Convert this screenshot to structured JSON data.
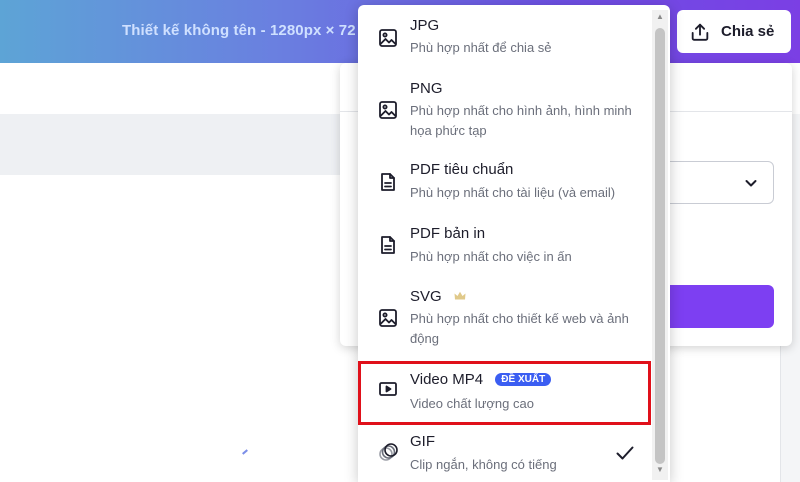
{
  "header": {
    "doc_title": "Thiết kế không tên - 1280px × 72",
    "share_label": "Chia sẻ"
  },
  "colors": {
    "accent": "#7d3ff2",
    "badge": "#3b5ef2",
    "highlight": "#e0101a"
  },
  "menu": {
    "items": [
      {
        "name": "JPG",
        "desc": "Phù hợp nhất để chia sẻ",
        "icon": "image-icon"
      },
      {
        "name": "PNG",
        "desc": "Phù hợp nhất cho hình ảnh, hình minh họa phức tạp",
        "icon": "image-icon"
      },
      {
        "name": "PDF tiêu chuẩn",
        "desc": "Phù hợp nhất cho tài liệu (và email)",
        "icon": "document-icon"
      },
      {
        "name": "PDF bản in",
        "desc": "Phù hợp nhất cho việc in ấn",
        "icon": "document-icon"
      },
      {
        "name": "SVG",
        "desc": "Phù hợp nhất cho thiết kế web và ảnh động",
        "icon": "image-icon",
        "premium": true
      },
      {
        "name": "Video MP4",
        "desc": "Video chất lượng cao",
        "icon": "video-play-icon",
        "badge": "ĐỀ XUẤT"
      },
      {
        "name": "GIF",
        "desc": "Clip ngắn, không có tiếng",
        "icon": "gif-circles-icon",
        "selected": true
      }
    ]
  }
}
